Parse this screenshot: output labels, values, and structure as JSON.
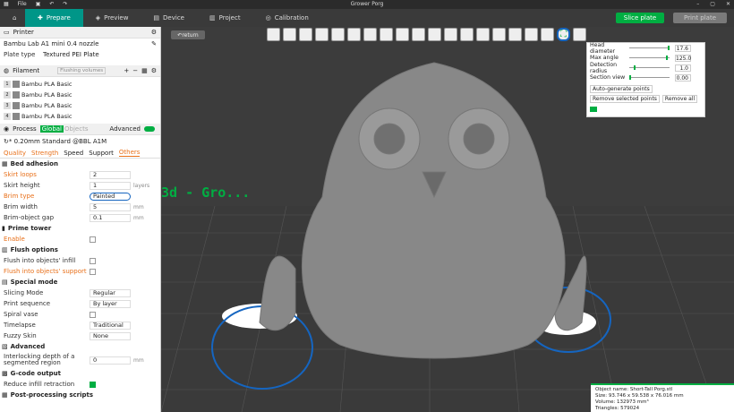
{
  "titlebar": {
    "file": "File",
    "title": "Grower Porg"
  },
  "tabs": [
    "Prepare",
    "Preview",
    "Device",
    "Project",
    "Calibration"
  ],
  "actions": {
    "slice": "Slice plate",
    "print": "Print plate"
  },
  "printer": {
    "section": "Printer",
    "name": "Bambu Lab A1 mini 0.4 nozzle",
    "plate_label": "Plate type",
    "plate_value": "Textured PEI Plate"
  },
  "filament": {
    "section": "Filament",
    "flushing": "Flushing volumes",
    "items": [
      {
        "n": "1",
        "name": "Bambu PLA Basic"
      },
      {
        "n": "2",
        "name": "Bambu PLA Basic"
      },
      {
        "n": "3",
        "name": "Bambu PLA Basic"
      },
      {
        "n": "4",
        "name": "Bambu PLA Basic"
      }
    ]
  },
  "process": {
    "section": "Process",
    "global": "Global",
    "objects": "Objects",
    "advanced": "Advanced",
    "profile": "* 0.20mm Standard @BBL A1M",
    "subtabs": [
      "Quality",
      "Strength",
      "Speed",
      "Support",
      "Others"
    ]
  },
  "groups": {
    "bed": "Bed adhesion",
    "prime": "Prime tower",
    "flush": "Flush options",
    "special": "Special mode",
    "advanced": "Advanced",
    "gcode": "G-code output",
    "post": "Post-processing scripts"
  },
  "settings": {
    "skirt_loops": {
      "label": "Skirt loops",
      "value": "2"
    },
    "skirt_height": {
      "label": "Skirt height",
      "value": "1",
      "unit": "layers"
    },
    "brim_type": {
      "label": "Brim type",
      "value": "Painted"
    },
    "brim_width": {
      "label": "Brim width",
      "value": "5",
      "unit": "mm"
    },
    "brim_gap": {
      "label": "Brim-object gap",
      "value": "0.1",
      "unit": "mm"
    },
    "enable": {
      "label": "Enable"
    },
    "flush_infill": {
      "label": "Flush into objects' infill"
    },
    "flush_support": {
      "label": "Flush into objects' support"
    },
    "slicing_mode": {
      "label": "Slicing Mode",
      "value": "Regular"
    },
    "print_seq": {
      "label": "Print sequence",
      "value": "By layer"
    },
    "spiral": {
      "label": "Spiral vase"
    },
    "timelapse": {
      "label": "Timelapse",
      "value": "Traditional"
    },
    "fuzzy": {
      "label": "Fuzzy Skin",
      "value": "None"
    },
    "interlock": {
      "label": "Interlocking depth of a segmented region",
      "value": "0",
      "unit": "mm"
    },
    "reduce": {
      "label": "Reduce infill retraction"
    }
  },
  "viewport": {
    "return": "return",
    "watermark": "3d - Gro..."
  },
  "popup": {
    "rows": [
      {
        "label": "Head diameter",
        "value": "17.6",
        "pos": 0.95
      },
      {
        "label": "Max angle",
        "value": "125.0",
        "pos": 0.9
      },
      {
        "label": "Detection radius",
        "value": "1.0",
        "pos": 0.1
      },
      {
        "label": "Section view",
        "value": "0.00",
        "pos": 0.0
      }
    ],
    "auto": "Auto-generate points",
    "remove_sel": "Remove selected points",
    "remove_all": "Remove all"
  },
  "info": {
    "name": "Object name: Short-Tall Porg.stl",
    "size": "Size: 93.746 x 59.538 x 76.016 mm",
    "volume": "Volume: 132973 mm³",
    "triangles": "Triangles: 579024"
  }
}
